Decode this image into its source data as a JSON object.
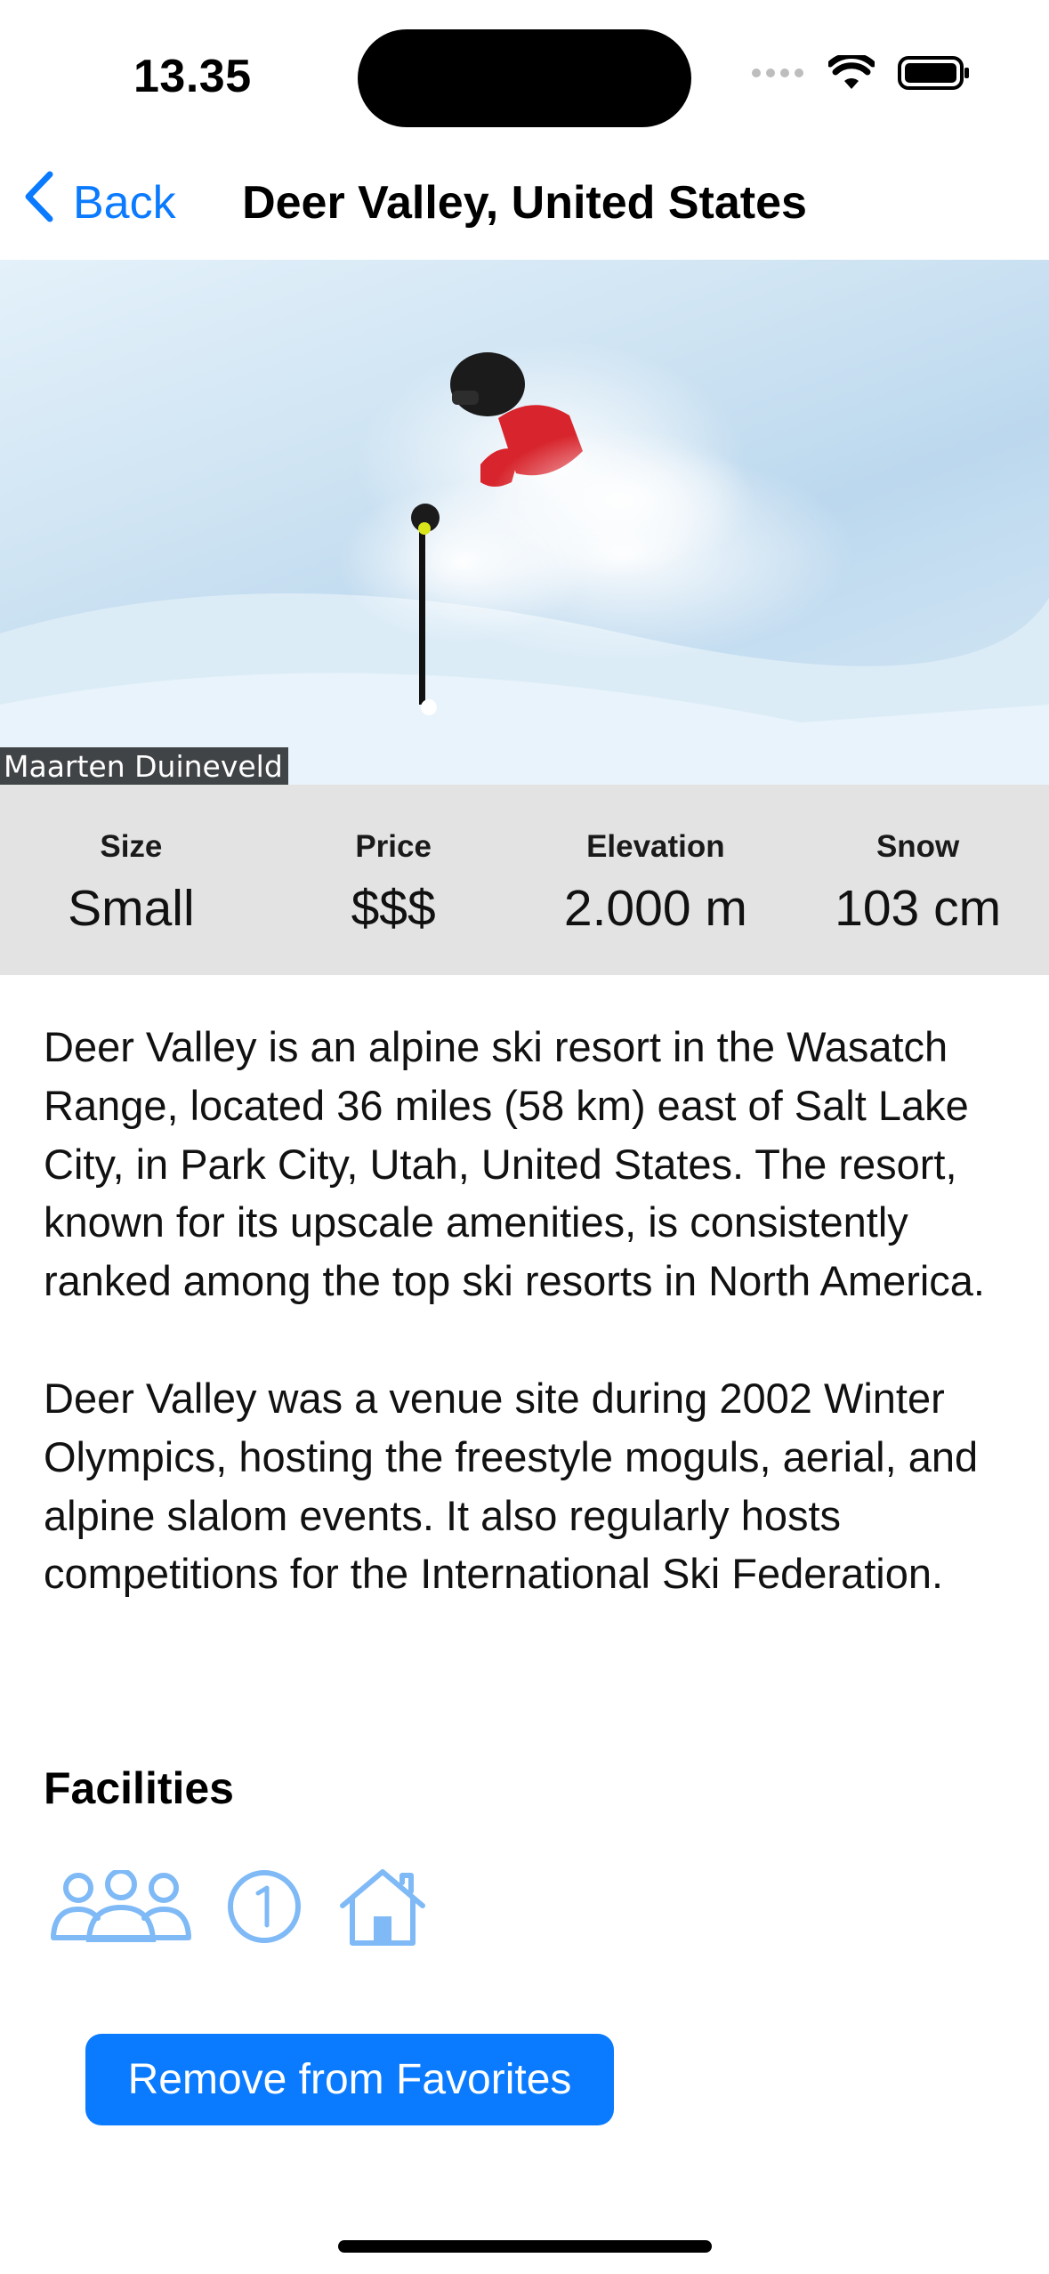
{
  "status_bar": {
    "time": "13.35",
    "icons": [
      "signal-icon",
      "wifi-icon",
      "battery-icon"
    ]
  },
  "nav": {
    "back_label": "Back",
    "title": "Deer Valley, United States",
    "accent_color": "#0a7aff"
  },
  "hero": {
    "photo_credit": "Maarten Duineveld"
  },
  "stats": [
    {
      "label": "Size",
      "value": "Small"
    },
    {
      "label": "Price",
      "value": "$$$"
    },
    {
      "label": "Elevation",
      "value": "2.000 m"
    },
    {
      "label": "Snow",
      "value": "103 cm"
    }
  ],
  "description": [
    "Deer Valley is an alpine ski resort in the Wasatch Range, located 36 miles (58 km) east of Salt Lake City, in Park City, Utah, United States. The resort, known for its upscale amenities, is consistently ranked among the top ski resorts in North America.",
    "Deer Valley was a venue site during 2002 Winter Olympics, hosting the freestyle moguls, aerial, and alpine slalom events. It also regularly hosts competitions for the International Ski Federation."
  ],
  "facilities": {
    "title": "Facilities",
    "icons": [
      "group-icon",
      "number-one-circle-icon",
      "house-icon"
    ],
    "icon_color": "#7fbaf7"
  },
  "action": {
    "remove_label": "Remove from Favorites",
    "color": "#0a7aff"
  }
}
